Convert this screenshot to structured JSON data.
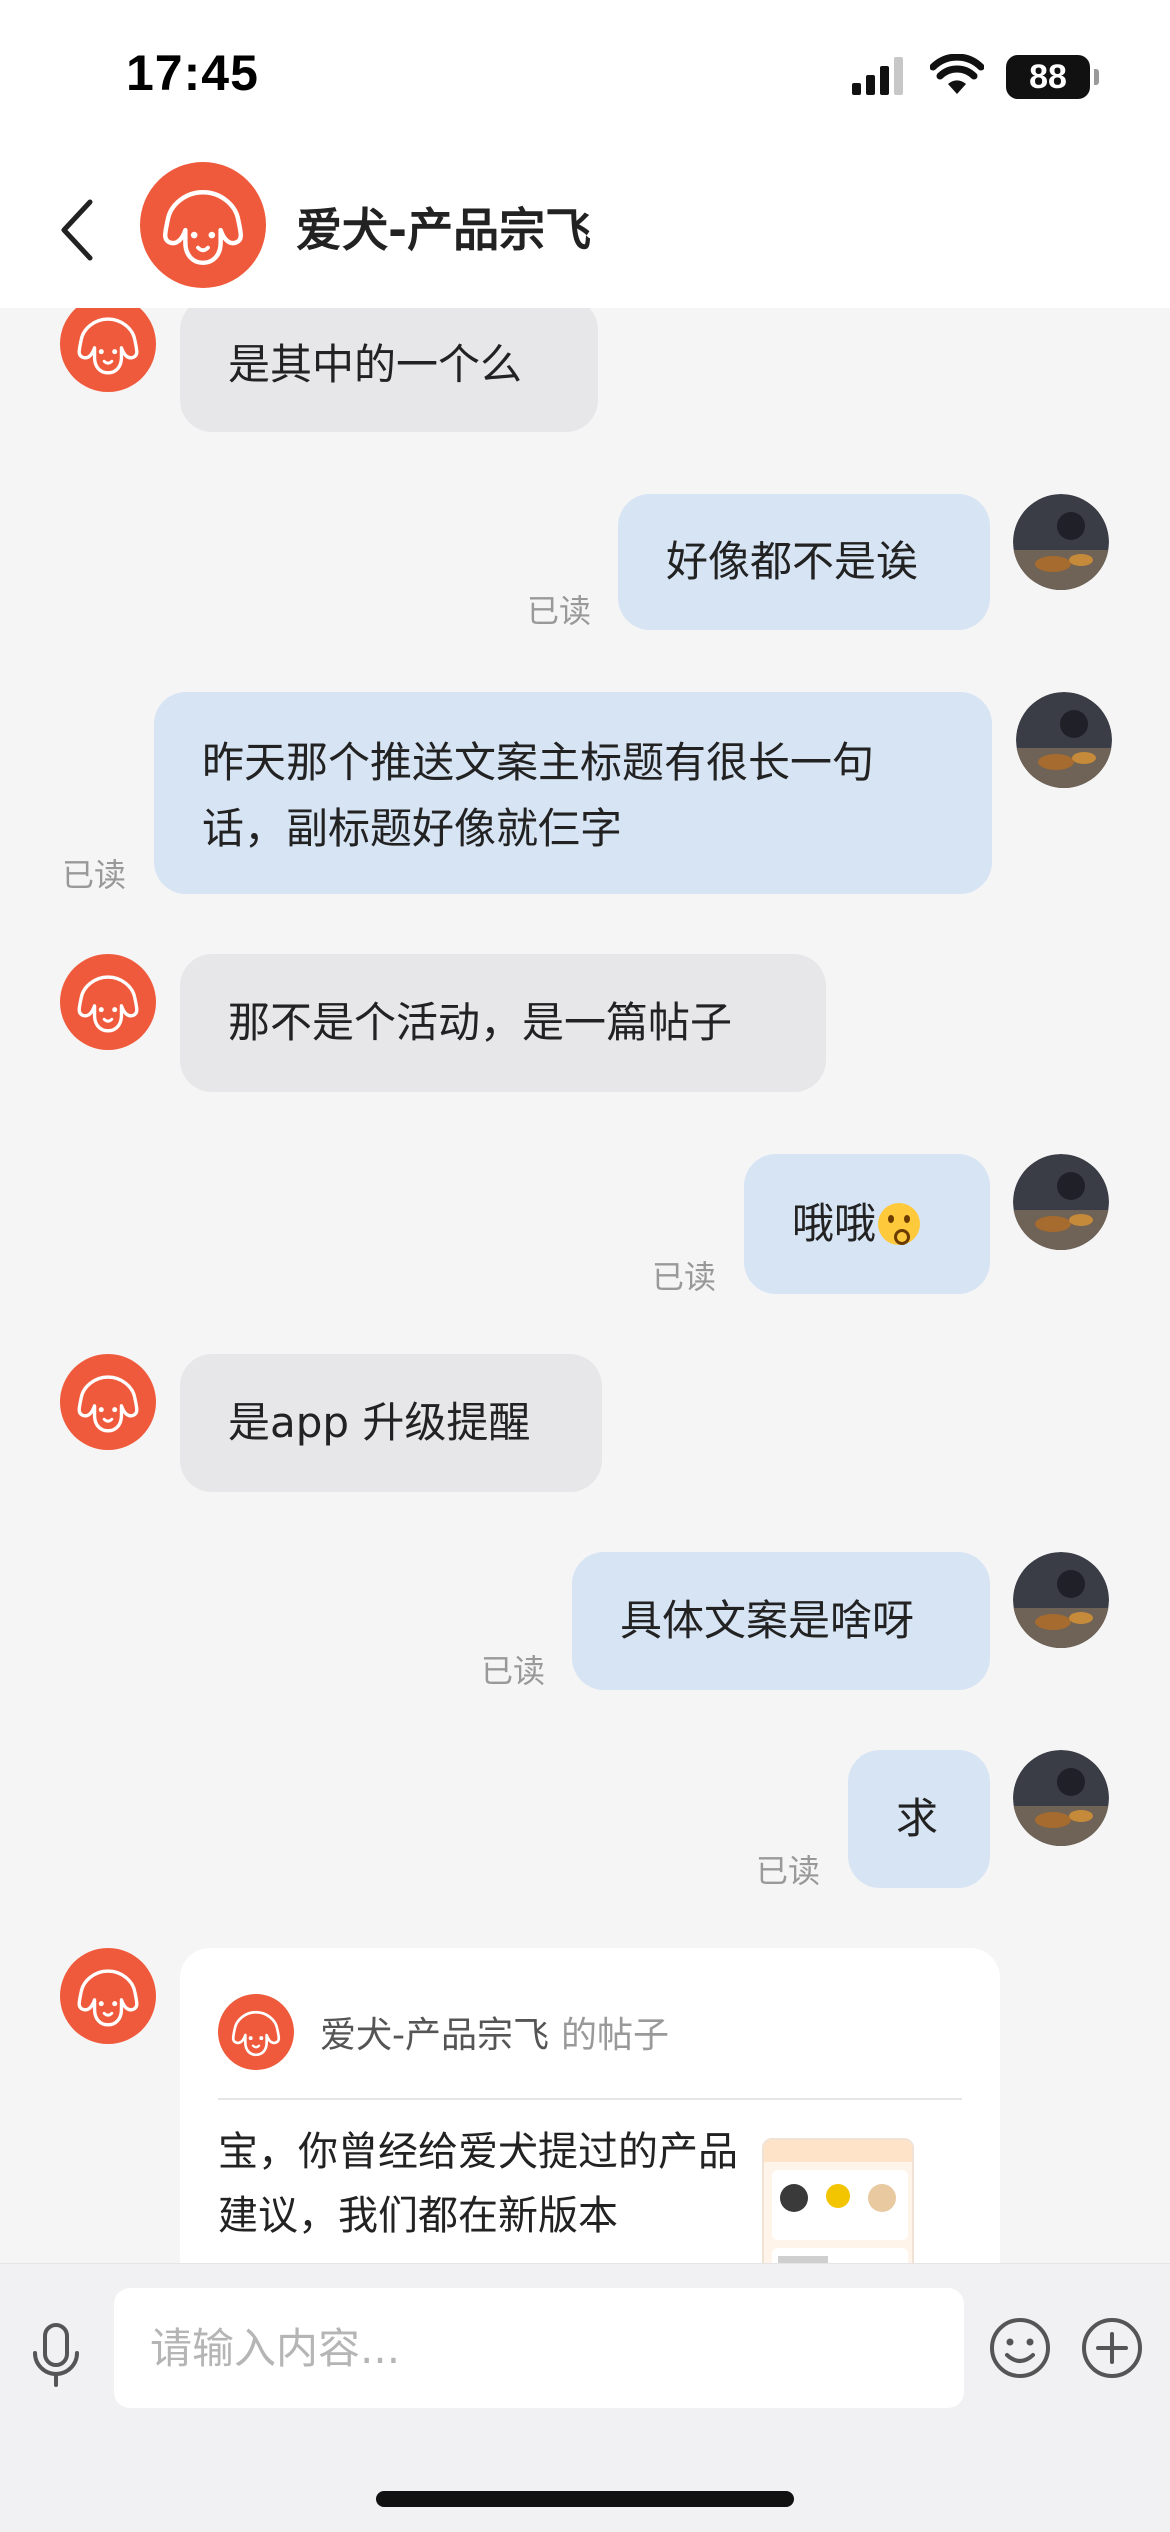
{
  "status_bar": {
    "time": "17:45",
    "battery": "88",
    "icons": [
      "cellular-signal-icon",
      "wifi-icon",
      "battery-icon"
    ]
  },
  "header": {
    "title": "爱犬-产品宗飞",
    "back_icon": "chevron-left-icon"
  },
  "colors": {
    "brand": "#f05a3c",
    "incoming_bubble": "#e7e7ea",
    "outgoing_bubble": "#d7e4f4"
  },
  "messages": [
    {
      "from": "them",
      "text": "是其中的一个么"
    },
    {
      "from": "me",
      "text": "好像都不是诶",
      "status": "已读"
    },
    {
      "from": "me",
      "text": "昨天那个推送文案主标题有很长一句话，副标题好像就仨字",
      "status": "已读"
    },
    {
      "from": "them",
      "text": "那不是个活动，是一篇帖子"
    },
    {
      "from": "me",
      "text": "哦哦",
      "emoji": "hushed-face-icon",
      "status": "已读"
    },
    {
      "from": "them",
      "text": "是app 升级提醒"
    },
    {
      "from": "me",
      "text": "具体文案是啥呀",
      "status": "已读"
    },
    {
      "from": "me",
      "text": "求",
      "status": "已读"
    }
  ],
  "post_card": {
    "author": "爱犬-产品宗飞",
    "suffix": "的帖子",
    "text": "宝，你曾经给爱犬提过的产品建议，我们都在新版本"
  },
  "input": {
    "placeholder": "请输入内容..."
  }
}
